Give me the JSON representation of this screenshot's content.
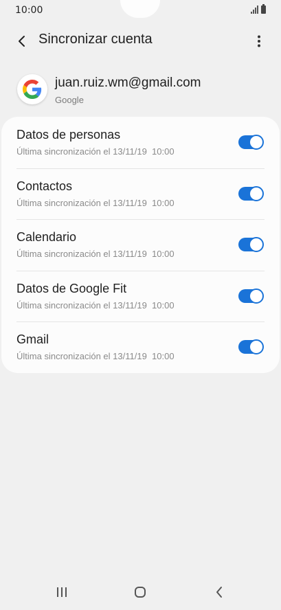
{
  "status_bar": {
    "time": "10:00"
  },
  "header": {
    "title": "Sincronizar cuenta"
  },
  "account": {
    "email": "juan.ruiz.wm@gmail.com",
    "provider": "Google"
  },
  "sync_items": [
    {
      "label": "Datos de personas",
      "subtitle": "Última sincronización el 13/11/19  10:00",
      "enabled": true
    },
    {
      "label": "Contactos",
      "subtitle": "Última sincronización el 13/11/19  10:00",
      "enabled": true
    },
    {
      "label": "Calendario",
      "subtitle": "Última sincronización el 13/11/19  10:00",
      "enabled": true
    },
    {
      "label": "Datos de Google Fit",
      "subtitle": "Última sincronización el 13/11/19  10:00",
      "enabled": true
    },
    {
      "label": "Gmail",
      "subtitle": "Última sincronización el 13/11/19  10:00",
      "enabled": true
    }
  ],
  "colors": {
    "accent": "#1a73d8",
    "background": "#f0f0f0",
    "card": "#fcfcfc"
  },
  "icons": {
    "back": "back-arrow-icon",
    "more": "more-vert-icon",
    "avatar": "google-logo-icon",
    "nav_recents": "recents-icon",
    "nav_home": "home-icon",
    "nav_back": "nav-back-icon"
  }
}
